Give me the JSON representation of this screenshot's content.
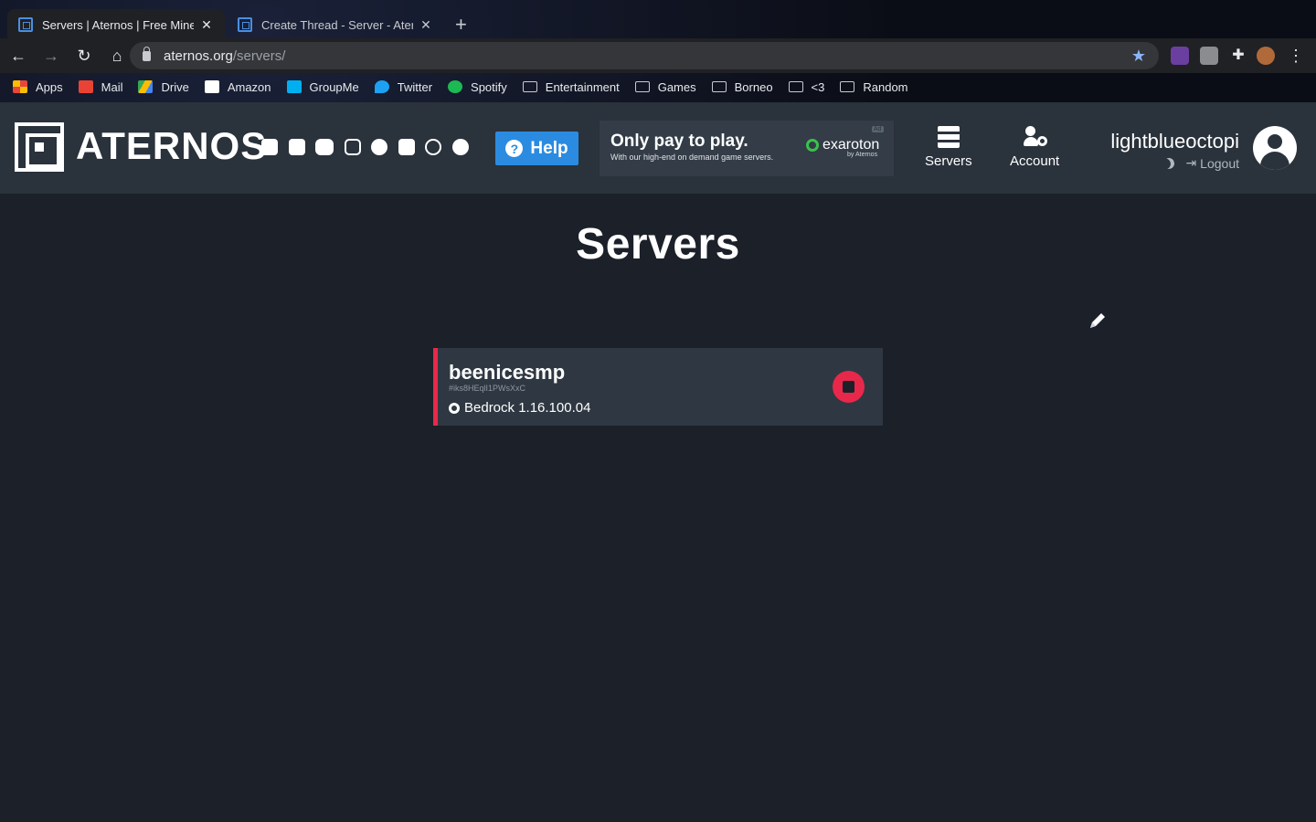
{
  "browser": {
    "tabs": [
      {
        "title": "Servers | Aternos | Free Minecr",
        "active": true
      },
      {
        "title": "Create Thread - Server - Atern",
        "active": false
      }
    ],
    "new_tab": "+",
    "close": "✕",
    "url_host": "aternos.org",
    "url_path": "/servers/",
    "bookmarks": [
      {
        "label": "Apps",
        "icon": "apps-grid-icon",
        "color": "#e8453c"
      },
      {
        "label": "Mail",
        "icon": "gmail-icon",
        "color": "#ea4335"
      },
      {
        "label": "Drive",
        "icon": "drive-icon",
        "color": "#fbbc04"
      },
      {
        "label": "Amazon",
        "icon": "amazon-icon",
        "color": "#ffffff"
      },
      {
        "label": "GroupMe",
        "icon": "groupme-icon",
        "color": "#00aff0"
      },
      {
        "label": "Twitter",
        "icon": "twitter-icon",
        "color": "#1da1f2"
      },
      {
        "label": "Spotify",
        "icon": "spotify-icon",
        "color": "#1db954"
      },
      {
        "label": "Entertainment",
        "icon": "folder-icon"
      },
      {
        "label": "Games",
        "icon": "folder-icon"
      },
      {
        "label": "Borneo",
        "icon": "folder-icon"
      },
      {
        "label": "<3",
        "icon": "folder-icon"
      },
      {
        "label": "Random",
        "icon": "folder-icon"
      }
    ]
  },
  "site": {
    "brand": "ATERNOS",
    "socials": [
      "twitter-icon",
      "facebook-icon",
      "youtube-icon",
      "instagram-icon",
      "reddit-icon",
      "discord-icon",
      "headset-icon",
      "github-icon"
    ],
    "help_label": "Help",
    "ad": {
      "headline": "Only pay to play.",
      "subline": "With our high-end on demand game servers.",
      "brand": "exaroton",
      "by": "by Aternos",
      "tag": "Ad"
    },
    "nav": {
      "servers_label": "Servers",
      "account_label": "Account"
    },
    "user": {
      "username": "lightblueoctopi",
      "logout_label": "Logout"
    }
  },
  "main": {
    "title": "Servers",
    "servers": [
      {
        "name": "beenicesmp",
        "id": "#iks8HEqlI1PWsXxC",
        "version": "Bedrock 1.16.100.04",
        "status_color": "#e8284a"
      }
    ]
  },
  "colors": {
    "accent": "#2b8be0",
    "offline": "#e8284a",
    "header_bg": "#2a323c",
    "page_bg": "#1b2029"
  }
}
